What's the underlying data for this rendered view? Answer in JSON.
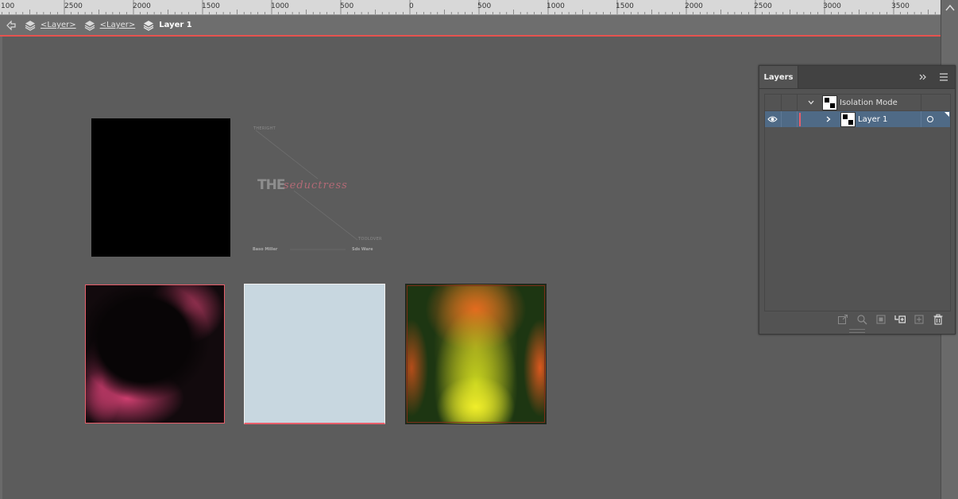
{
  "ruler": {
    "labels": [
      "100",
      "2500",
      "2000",
      "1500",
      "1000",
      "500",
      "0",
      "500",
      "1000",
      "1500",
      "2000",
      "2500",
      "3000",
      "3500"
    ]
  },
  "breadcrumb": {
    "items": [
      {
        "label": "<Layer>",
        "icon": "layer-stack-icon"
      },
      {
        "label": "<Layer>",
        "icon": "layer-stack-icon"
      },
      {
        "label": "Layer 1",
        "icon": "layer-stack-icon"
      }
    ]
  },
  "artwork": {
    "mock_text_top": "THERIGHT",
    "mock_the": "THE",
    "mock_script": "seductress",
    "mock_text_right": "TOOLOVER",
    "mock_bottom_left": "Baso Miller",
    "mock_bottom_right": "Sds Ware"
  },
  "layers_panel": {
    "tab_label": "Layers",
    "rows": [
      {
        "label": "Isolation Mode"
      },
      {
        "label": "Layer 1"
      }
    ]
  },
  "colors": {
    "accent_red": "#e85e6a",
    "selection_blue": "#4f6a86"
  }
}
